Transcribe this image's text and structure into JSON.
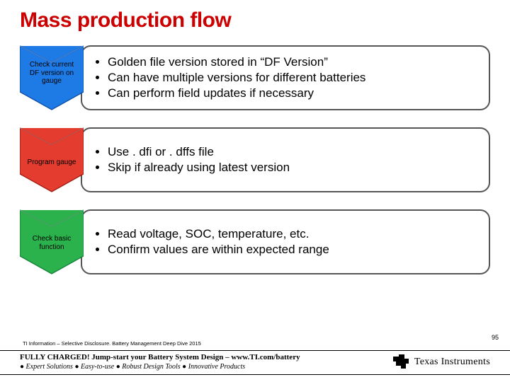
{
  "title": "Mass production flow",
  "rows": [
    {
      "chev_label": "Check current DF version on gauge",
      "chev_fill": "#1E7BE6",
      "chev_stroke": "#0F4FA8",
      "bullets": [
        "Golden file version stored in “DF Version”",
        "Can have multiple versions for different batteries",
        "Can perform field updates if necessary"
      ]
    },
    {
      "chev_label": "Program  gauge",
      "chev_fill": "#E43C2F",
      "chev_stroke": "#A11E14",
      "bullets": [
        "Use . dfi or . dffs file",
        "Skip if already using latest version"
      ]
    },
    {
      "chev_label": "Check basic function",
      "chev_fill": "#2BB24C",
      "chev_stroke": "#17823A",
      "bullets": [
        "Read voltage, SOC, temperature, etc.",
        "Confirm values are within expected range"
      ]
    }
  ],
  "disclosure": "TI Information – Selective Disclosure. Battery Management Deep Dive 2015",
  "page_number": "95",
  "footer": {
    "line1": "FULLY CHARGED! Jump-start your Battery System Design – www.TI.com/battery",
    "items": [
      "Expert Solutions",
      "Easy-to-use",
      "Robust Design Tools",
      "Innovative Products"
    ]
  },
  "logo": {
    "name": "Texas Instruments",
    "icon_fill": "#000"
  }
}
